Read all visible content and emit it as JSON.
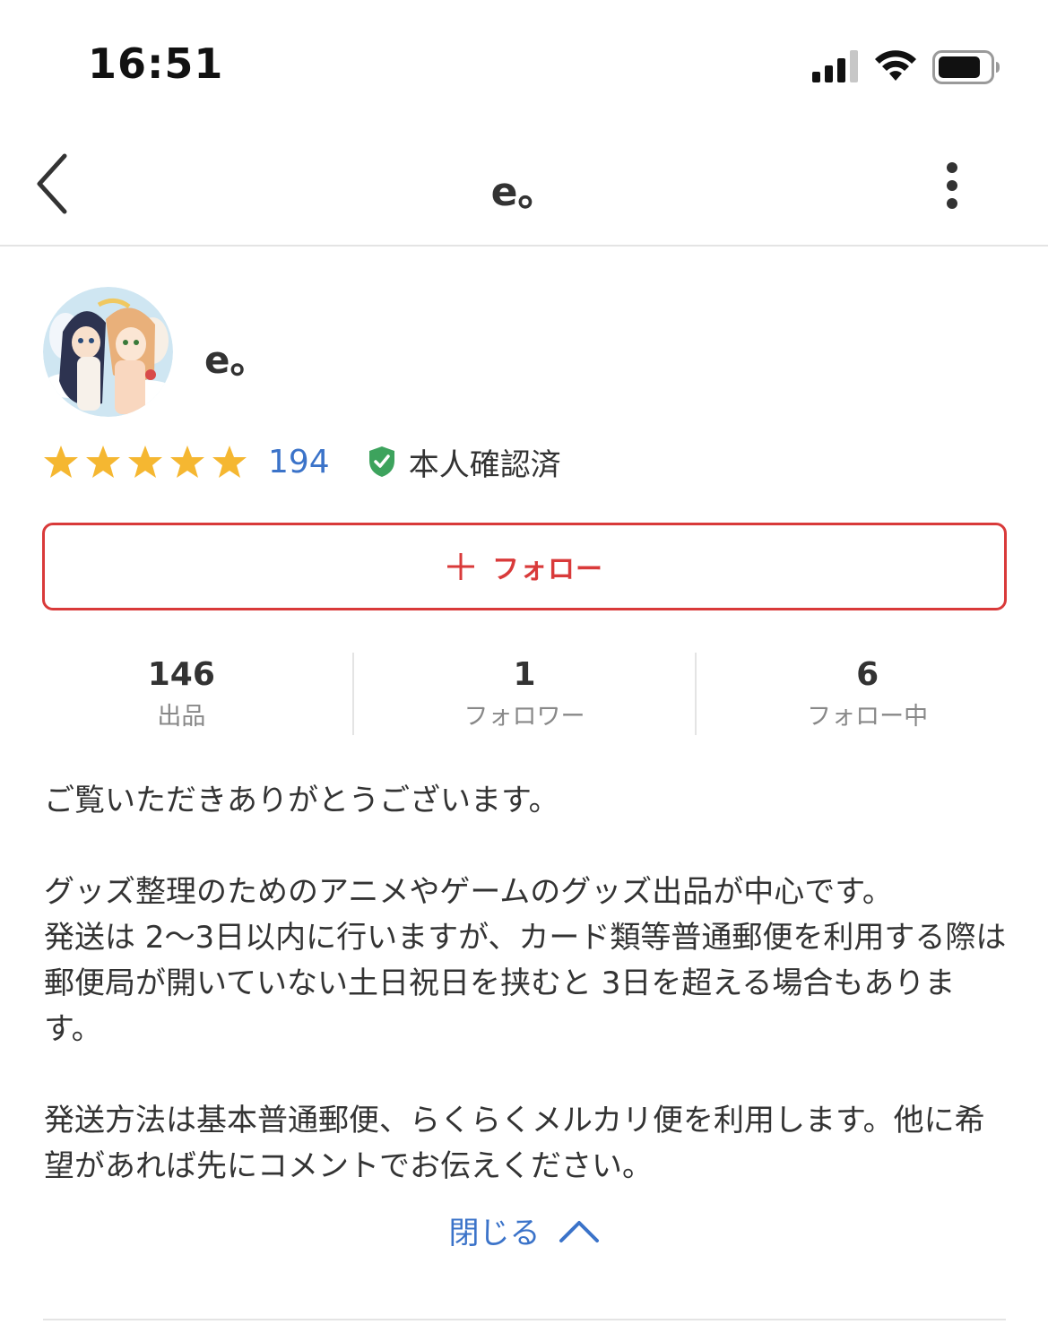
{
  "status_bar": {
    "time": "16:51",
    "signal_icon": "cellular-signal-icon",
    "wifi_icon": "wifi-icon",
    "battery_icon": "battery-icon"
  },
  "nav": {
    "back_icon": "chevron-left-icon",
    "title": "e。",
    "menu_icon": "more-vertical-icon"
  },
  "profile": {
    "avatar_icon": "avatar-illustration",
    "name": "e。",
    "rating": 5,
    "rating_max": 5,
    "review_count": "194",
    "verified_icon": "shield-check-icon",
    "verified_label": "本人確認済"
  },
  "follow_button": {
    "icon": "plus-icon",
    "label": "フォロー"
  },
  "stats": [
    {
      "value": "146",
      "label": "出品"
    },
    {
      "value": "1",
      "label": "フォロワー"
    },
    {
      "value": "6",
      "label": "フォロー中"
    }
  ],
  "bio": {
    "paragraphs": [
      "ご覧いただきありがとうございます。",
      "グッズ整理のためのアニメやゲームのグッズ出品が中心です。\n発送は 2〜3日以内に行いますが、カード類等普通郵便を利用する際は郵便局が開いていない土日祝日を挟むと 3日を超える場合もあります。",
      "発送方法は基本普通郵便、らくらくメルカリ便を利用します。他に希望があれば先にコメントでお伝えください。"
    ]
  },
  "close_toggle": {
    "label": "閉じる",
    "icon": "chevron-up-icon"
  },
  "colors": {
    "accent_red": "#d93a3a",
    "link_blue": "#3b73c9",
    "star_yellow": "#f5b731",
    "verified_green": "#3da35d"
  }
}
